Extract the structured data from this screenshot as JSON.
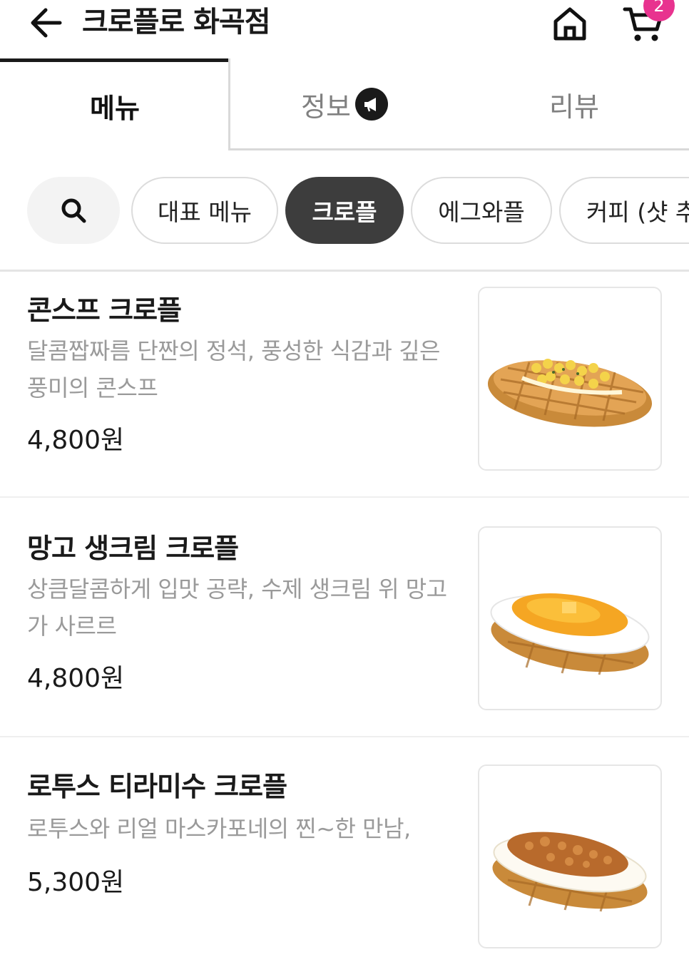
{
  "header": {
    "title": "크로플로 화곡점",
    "cart_count": "2",
    "back_icon": "arrow-left-icon",
    "home_icon": "home-icon",
    "cart_icon": "cart-icon"
  },
  "tabs": [
    {
      "label": "메뉴",
      "active": true
    },
    {
      "label": "정보",
      "active": false,
      "badge_icon": "megaphone-icon"
    },
    {
      "label": "리뷰",
      "active": false
    }
  ],
  "categories": [
    {
      "label": "대표 메뉴",
      "selected": false
    },
    {
      "label": "크로플",
      "selected": true
    },
    {
      "label": "에그와플",
      "selected": false
    },
    {
      "label": "커피 (샷 추",
      "selected": false
    }
  ],
  "menu_items": [
    {
      "name": "콘스프 크로플",
      "description": "달콤짭짜름 단짠의 정석, 풍성한 식감과 깊은 풍미의 콘스프",
      "price": "4,800원"
    },
    {
      "name": "망고 생크림 크로플",
      "description": "상큼달콤하게 입맛 공략, 수제 생크림 위 망고가 사르르",
      "price": "4,800원"
    },
    {
      "name": "로투스 티라미수 크로플",
      "description": "로투스와 리얼 마스카포네의 찐~한 만남,",
      "price": "5,300원"
    }
  ],
  "colors": {
    "accent_badge": "#e8338f",
    "chip_selected": "#3d3d3d",
    "text_muted": "#9a9a9a"
  }
}
